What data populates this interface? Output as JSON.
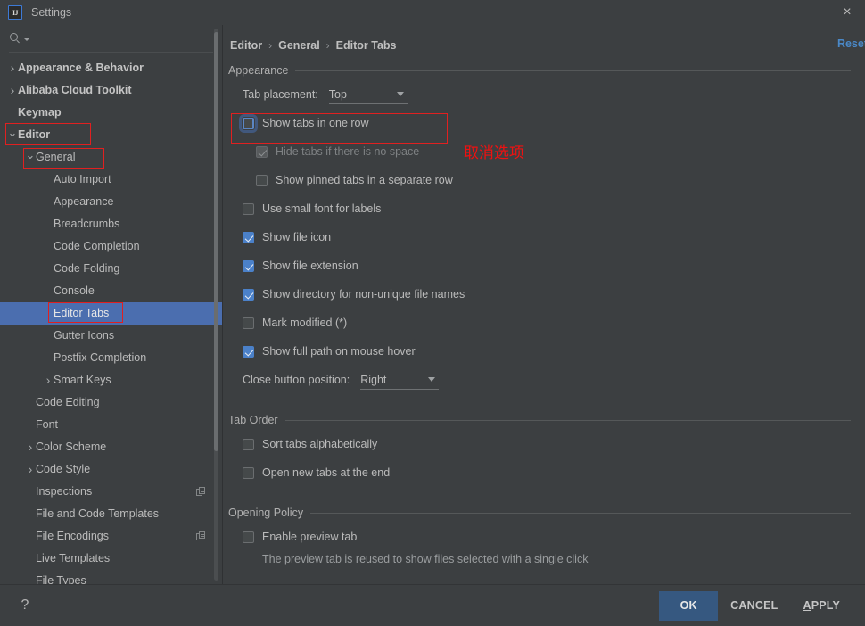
{
  "window": {
    "title": "Settings",
    "logo_text": "IJ",
    "close_icon": "×"
  },
  "sidebar": {
    "search": {
      "value": "",
      "placeholder": ""
    },
    "items": [
      {
        "label": "Appearance & Behavior",
        "indent": 0,
        "arrow": "collapsed",
        "bold": true,
        "selected": false,
        "copy": false
      },
      {
        "label": "Alibaba Cloud Toolkit",
        "indent": 0,
        "arrow": "collapsed",
        "bold": true,
        "selected": false,
        "copy": false
      },
      {
        "label": "Keymap",
        "indent": 0,
        "arrow": "none",
        "bold": true,
        "selected": false,
        "copy": false
      },
      {
        "label": "Editor",
        "indent": 0,
        "arrow": "expanded",
        "bold": true,
        "selected": false,
        "copy": false
      },
      {
        "label": "General",
        "indent": 1,
        "arrow": "expanded",
        "bold": false,
        "selected": false,
        "copy": false
      },
      {
        "label": "Auto Import",
        "indent": 2,
        "arrow": "none",
        "bold": false,
        "selected": false,
        "copy": false
      },
      {
        "label": "Appearance",
        "indent": 2,
        "arrow": "none",
        "bold": false,
        "selected": false,
        "copy": false
      },
      {
        "label": "Breadcrumbs",
        "indent": 2,
        "arrow": "none",
        "bold": false,
        "selected": false,
        "copy": false
      },
      {
        "label": "Code Completion",
        "indent": 2,
        "arrow": "none",
        "bold": false,
        "selected": false,
        "copy": false
      },
      {
        "label": "Code Folding",
        "indent": 2,
        "arrow": "none",
        "bold": false,
        "selected": false,
        "copy": false
      },
      {
        "label": "Console",
        "indent": 2,
        "arrow": "none",
        "bold": false,
        "selected": false,
        "copy": false
      },
      {
        "label": "Editor Tabs",
        "indent": 2,
        "arrow": "none",
        "bold": false,
        "selected": true,
        "copy": false
      },
      {
        "label": "Gutter Icons",
        "indent": 2,
        "arrow": "none",
        "bold": false,
        "selected": false,
        "copy": false
      },
      {
        "label": "Postfix Completion",
        "indent": 2,
        "arrow": "none",
        "bold": false,
        "selected": false,
        "copy": false
      },
      {
        "label": "Smart Keys",
        "indent": 2,
        "arrow": "collapsed",
        "bold": false,
        "selected": false,
        "copy": false
      },
      {
        "label": "Code Editing",
        "indent": 1,
        "arrow": "none",
        "bold": false,
        "selected": false,
        "copy": false
      },
      {
        "label": "Font",
        "indent": 1,
        "arrow": "none",
        "bold": false,
        "selected": false,
        "copy": false
      },
      {
        "label": "Color Scheme",
        "indent": 1,
        "arrow": "collapsed",
        "bold": false,
        "selected": false,
        "copy": false
      },
      {
        "label": "Code Style",
        "indent": 1,
        "arrow": "collapsed",
        "bold": false,
        "selected": false,
        "copy": false
      },
      {
        "label": "Inspections",
        "indent": 1,
        "arrow": "none",
        "bold": false,
        "selected": false,
        "copy": true
      },
      {
        "label": "File and Code Templates",
        "indent": 1,
        "arrow": "none",
        "bold": false,
        "selected": false,
        "copy": false
      },
      {
        "label": "File Encodings",
        "indent": 1,
        "arrow": "none",
        "bold": false,
        "selected": false,
        "copy": true
      },
      {
        "label": "Live Templates",
        "indent": 1,
        "arrow": "none",
        "bold": false,
        "selected": false,
        "copy": false
      },
      {
        "label": "File Types",
        "indent": 1,
        "arrow": "none",
        "bold": false,
        "selected": false,
        "copy": false
      }
    ]
  },
  "main": {
    "breadcrumb": [
      "Editor",
      "General",
      "Editor Tabs"
    ],
    "breadcrumb_separator": "›",
    "reset_label": "Reset",
    "sections": {
      "appearance": "Appearance",
      "tab_order": "Tab Order",
      "opening_policy": "Opening Policy"
    },
    "tab_placement": {
      "label": "Tab placement:",
      "value": "Top"
    },
    "close_button_position": {
      "label": "Close button position:",
      "value": "Right"
    },
    "checkboxes": {
      "show_tabs_one_row": {
        "label": "Show tabs in one row",
        "checked": false,
        "disabled": false,
        "focused": true
      },
      "hide_tabs_no_space": {
        "label": "Hide tabs if there is no space",
        "checked": true,
        "disabled": true,
        "focused": false
      },
      "show_pinned_separate": {
        "label": "Show pinned tabs in a separate row",
        "checked": false,
        "disabled": false,
        "focused": false
      },
      "use_small_font": {
        "label": "Use small font for labels",
        "checked": false,
        "disabled": false,
        "focused": false
      },
      "show_file_icon": {
        "label": "Show file icon",
        "checked": true,
        "disabled": false,
        "focused": false
      },
      "show_file_extension": {
        "label": "Show file extension",
        "checked": true,
        "disabled": false,
        "focused": false
      },
      "show_directory": {
        "label": "Show directory for non-unique file names",
        "checked": true,
        "disabled": false,
        "focused": false
      },
      "mark_modified": {
        "label": "Mark modified (*)",
        "checked": false,
        "disabled": false,
        "focused": false
      },
      "show_full_path": {
        "label": "Show full path on mouse hover",
        "checked": true,
        "disabled": false,
        "focused": false
      },
      "sort_alphabetically": {
        "label": "Sort tabs alphabetically",
        "checked": false,
        "disabled": false,
        "focused": false
      },
      "open_new_at_end": {
        "label": "Open new tabs at the end",
        "checked": false,
        "disabled": false,
        "focused": false
      },
      "enable_preview_tab": {
        "label": "Enable preview tab",
        "checked": false,
        "disabled": false,
        "focused": false
      }
    },
    "preview_hint": "The preview tab is reused to show files selected with a single click"
  },
  "annotations": {
    "cancel_option": "取消选项"
  },
  "footer": {
    "help_label": "?",
    "ok_label": "OK",
    "cancel_label": "CANCEL",
    "apply_label_pre": "A",
    "apply_label_post": "PPLY"
  },
  "colors": {
    "accent": "#4b81c9",
    "selection": "#4b6eaf",
    "primary_button": "#365880",
    "link": "#4a88c7",
    "annotation_red": "#ee1111",
    "background": "#3c3f41"
  }
}
